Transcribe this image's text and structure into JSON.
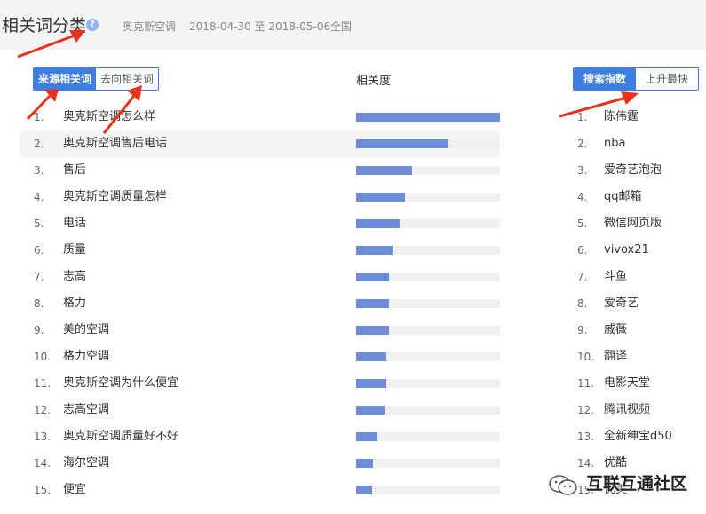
{
  "header": {
    "title": "相关词分类",
    "keyword": "奥克斯空调",
    "date_range": "2018-04-30 至 2018-05-06",
    "region": "全国",
    "help_icon": "question-icon"
  },
  "left_toggle": {
    "options": [
      "来源相关词",
      "去向相关词"
    ],
    "active_index": 0
  },
  "right_toggle": {
    "options": [
      "搜索指数",
      "上升最快"
    ],
    "active_index": 0
  },
  "column_header": "相关度",
  "relevance_rows": [
    {
      "rank": "1.",
      "keyword": "奥克斯空调怎么样",
      "relevance": 1.0
    },
    {
      "rank": "2.",
      "keyword": "奥克斯空调售后电话",
      "relevance": 0.64
    },
    {
      "rank": "3.",
      "keyword": "售后",
      "relevance": 0.39
    },
    {
      "rank": "4.",
      "keyword": "奥克斯空调质量怎样",
      "relevance": 0.34
    },
    {
      "rank": "5.",
      "keyword": "电话",
      "relevance": 0.3
    },
    {
      "rank": "6.",
      "keyword": "质量",
      "relevance": 0.25
    },
    {
      "rank": "7.",
      "keyword": "志高",
      "relevance": 0.23
    },
    {
      "rank": "8.",
      "keyword": "格力",
      "relevance": 0.23
    },
    {
      "rank": "9.",
      "keyword": "美的空调",
      "relevance": 0.23
    },
    {
      "rank": "10.",
      "keyword": "格力空调",
      "relevance": 0.21
    },
    {
      "rank": "11.",
      "keyword": "奥克斯空调为什么便宜",
      "relevance": 0.21
    },
    {
      "rank": "12.",
      "keyword": "志高空调",
      "relevance": 0.2
    },
    {
      "rank": "13.",
      "keyword": "奥克斯空调质量好不好",
      "relevance": 0.15
    },
    {
      "rank": "14.",
      "keyword": "海尔空调",
      "relevance": 0.12
    },
    {
      "rank": "15.",
      "keyword": "便宜",
      "relevance": 0.11
    }
  ],
  "search_index_list": [
    {
      "rank": "1.",
      "keyword": "陈伟霆"
    },
    {
      "rank": "2.",
      "keyword": "nba"
    },
    {
      "rank": "3.",
      "keyword": "爱奇艺泡泡"
    },
    {
      "rank": "4.",
      "keyword": "qq邮箱"
    },
    {
      "rank": "5.",
      "keyword": "微信网页版"
    },
    {
      "rank": "6.",
      "keyword": "vivox21"
    },
    {
      "rank": "7.",
      "keyword": "斗鱼"
    },
    {
      "rank": "8.",
      "keyword": "爱奇艺"
    },
    {
      "rank": "9.",
      "keyword": "戚薇"
    },
    {
      "rank": "10.",
      "keyword": "翻译"
    },
    {
      "rank": "11.",
      "keyword": "电影天堂"
    },
    {
      "rank": "12.",
      "keyword": "腾讯视频"
    },
    {
      "rank": "13.",
      "keyword": "全新绅宝d50"
    },
    {
      "rank": "14.",
      "keyword": "优酷"
    },
    {
      "rank": "15.",
      "keyword": "优美"
    }
  ],
  "watermark": {
    "text": "互联互通社区",
    "icon": "wechat-icon"
  },
  "colors": {
    "accent": "#3c7fe1",
    "bar": "#6f8bdb",
    "arrow": "#e8321e",
    "header_bg": "#f3f4f6"
  }
}
